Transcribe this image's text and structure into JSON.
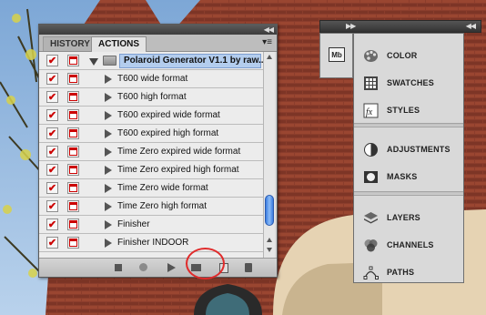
{
  "actions_panel": {
    "tabs": {
      "history": "HISTORY",
      "actions": "ACTIONS"
    },
    "action_set": "Polaroid Generator V1.1 by raw...",
    "actions": [
      "T600 wide format",
      "T600 high format",
      "T600 expired wide format",
      "T600 expired high format",
      "Time Zero expired wide format",
      "Time Zero expired high format",
      "Time Zero wide format",
      "Time Zero high format",
      "Finisher",
      "Finisher INDOOR"
    ],
    "check_marks": [
      "✔",
      "✔",
      "✔",
      "✔",
      "✔",
      "✔",
      "✔",
      "✔",
      "✔",
      "✔",
      "✔"
    ]
  },
  "dock": {
    "mini_icon_label": "Mb",
    "groups": [
      [
        "COLOR",
        "SWATCHES",
        "STYLES"
      ],
      [
        "ADJUSTMENTS",
        "MASKS"
      ],
      [
        "LAYERS",
        "CHANNELS",
        "PATHS"
      ]
    ]
  },
  "colors": {
    "selection": "#b3cdee",
    "checkmark": "#cc0000",
    "annotation_circle": "#e02b2b",
    "scroll_thumb": "#3a7be0"
  },
  "icons": {
    "panel_menu": "panel-menu-icon",
    "stop": "stop-icon",
    "record": "record-icon",
    "play": "play-icon",
    "new_set": "folder-icon",
    "new_action": "new-item-icon",
    "delete": "trash-icon"
  }
}
